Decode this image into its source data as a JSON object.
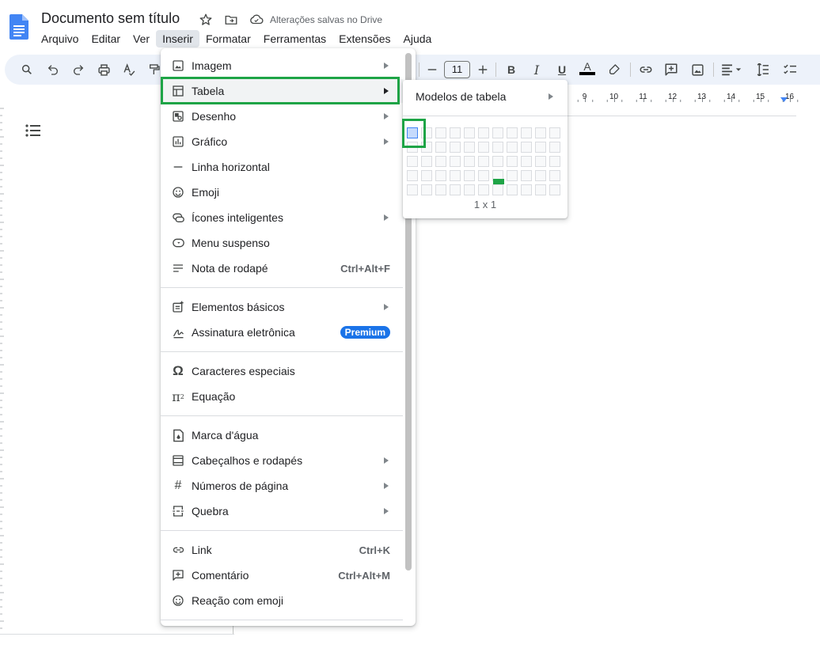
{
  "document": {
    "title": "Documento sem título",
    "save_status": "Alterações salvas no Drive"
  },
  "menubar": [
    "Arquivo",
    "Editar",
    "Ver",
    "Inserir",
    "Formatar",
    "Ferramentas",
    "Extensões",
    "Ajuda"
  ],
  "menubar_active": "Inserir",
  "toolbar": {
    "font_size": "11",
    "text_color": "#000000"
  },
  "ruler_labels": [
    "9",
    "10",
    "11",
    "12",
    "13",
    "14",
    "15",
    "16"
  ],
  "insert_menu": {
    "items": [
      {
        "label": "Imagem",
        "icon": "image-icon",
        "submenu": true
      },
      {
        "label": "Tabela",
        "icon": "table-icon",
        "submenu": true,
        "highlighted": true
      },
      {
        "label": "Desenho",
        "icon": "drawing-icon",
        "submenu": true
      },
      {
        "label": "Gráfico",
        "icon": "chart-icon",
        "submenu": true
      },
      {
        "label": "Linha horizontal",
        "icon": "horizontal-line-icon"
      },
      {
        "label": "Emoji",
        "icon": "emoji-icon"
      },
      {
        "label": "Ícones inteligentes",
        "icon": "smart-chips-icon",
        "submenu": true
      },
      {
        "label": "Menu suspenso",
        "icon": "dropdown-icon"
      },
      {
        "label": "Nota de rodapé",
        "icon": "footnote-icon",
        "shortcut": "Ctrl+Alt+F"
      },
      {
        "label": "Elementos básicos",
        "icon": "building-blocks-icon",
        "submenu": true
      },
      {
        "label": "Assinatura eletrônica",
        "icon": "esignature-icon",
        "badge": "Premium"
      },
      {
        "label": "Caracteres especiais",
        "icon": "omega-icon"
      },
      {
        "label": "Equação",
        "icon": "pi-icon"
      },
      {
        "label": "Marca d'água",
        "icon": "watermark-icon"
      },
      {
        "label": "Cabeçalhos e rodapés",
        "icon": "header-footer-icon",
        "submenu": true
      },
      {
        "label": "Números de página",
        "icon": "hash-icon",
        "submenu": true
      },
      {
        "label": "Quebra",
        "icon": "page-break-icon",
        "submenu": true
      },
      {
        "label": "Link",
        "icon": "link-icon",
        "shortcut": "Ctrl+K"
      },
      {
        "label": "Comentário",
        "icon": "add-comment-icon",
        "shortcut": "Ctrl+Alt+M"
      },
      {
        "label": "Reação com emoji",
        "icon": "emoji-reaction-icon"
      }
    ]
  },
  "table_submenu": {
    "templates_label": "Modelos de tabela",
    "grid_size": "1 x 1",
    "grid_columns": 11,
    "grid_rows": 5,
    "selected_rows": 1,
    "selected_cols": 1
  },
  "colors": {
    "annotation_green": "#1ea446",
    "toolbar_bg": "#edf2fa",
    "accent_blue": "#1a73e8"
  }
}
